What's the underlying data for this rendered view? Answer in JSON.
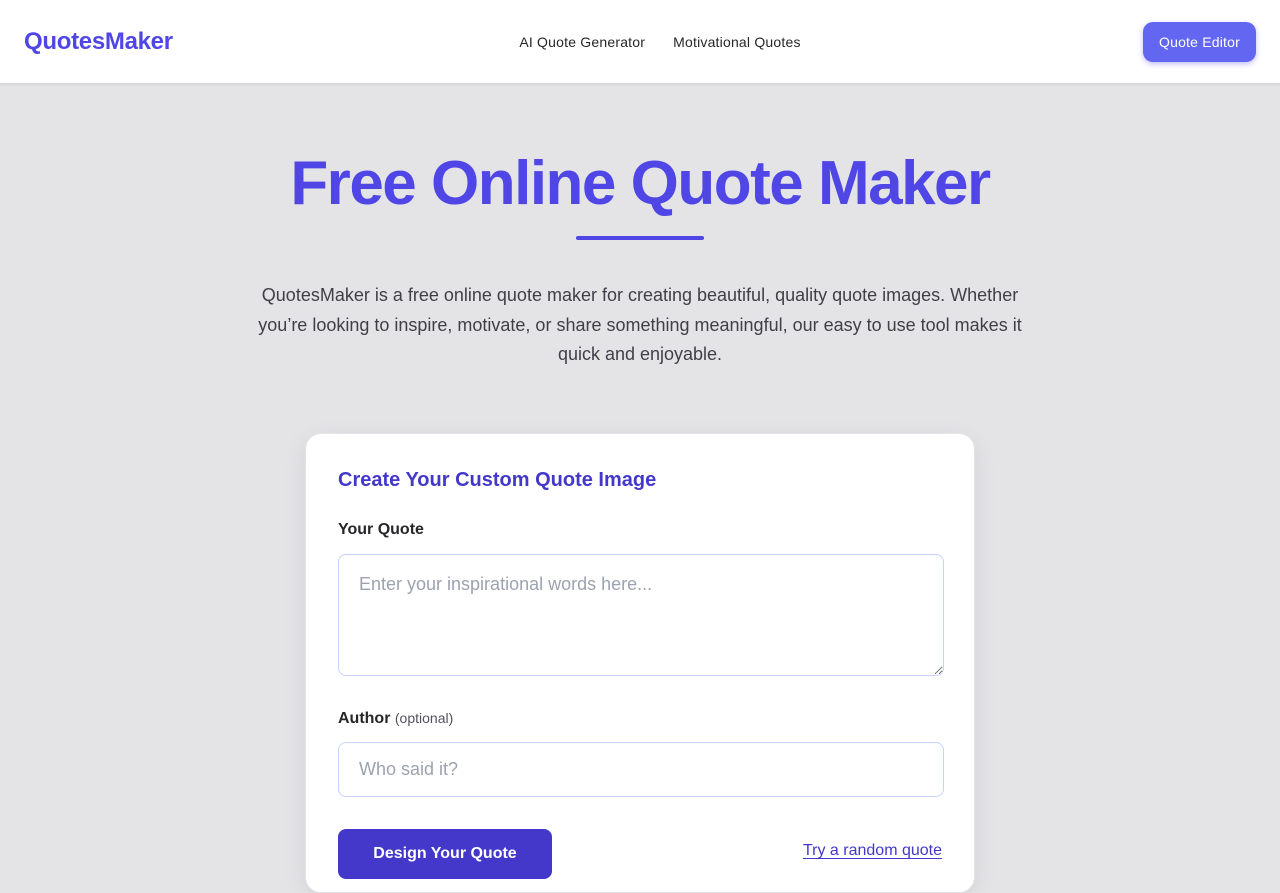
{
  "header": {
    "brand": "QuotesMaker",
    "nav": [
      {
        "label": "AI Quote Generator"
      },
      {
        "label": "Motivational Quotes"
      }
    ],
    "cta_label": "Quote Editor"
  },
  "hero": {
    "title": "Free Online Quote Maker",
    "description": "QuotesMaker is a free online quote maker for creating beautiful, quality quote images. Whether you’re looking to inspire, motivate, or share something meaningful, our easy to use tool makes it quick and enjoyable."
  },
  "form": {
    "title": "Create Your Custom Quote Image",
    "quote": {
      "label": "Your Quote",
      "value": "",
      "placeholder": "Enter your inspirational words here..."
    },
    "author": {
      "label": "Author",
      "optional_label": "(optional)",
      "value": "",
      "placeholder": "Who said it?"
    },
    "submit_label": "Design Your Quote",
    "random_link": "Try a random quote"
  },
  "colors": {
    "brand": "#4f46e5",
    "accent": "#6366f1",
    "button": "#4338ca",
    "background": "#e4e4e7"
  }
}
